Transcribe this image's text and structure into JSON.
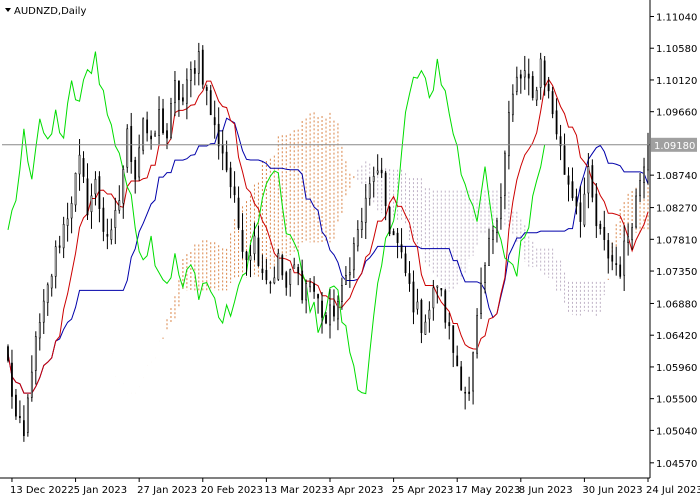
{
  "chart_data": {
    "type": "line",
    "title": "AUDNZD,Daily",
    "symbol": "AUDNZD",
    "timeframe": "Daily",
    "ylim": [
      1.0435,
      1.1125
    ],
    "yticks": [
      "1.11040",
      "1.10580",
      "1.10120",
      "1.09660",
      "1.08740",
      "1.08270",
      "1.07810",
      "1.07350",
      "1.06880",
      "1.06420",
      "1.05960",
      "1.05500",
      "1.05040",
      "1.04570"
    ],
    "current_price": "1.09180",
    "current_price_value": 1.0918,
    "xticks": [
      "13 Dec 2022",
      "5 Jan 2023",
      "27 Jan 2023",
      "20 Feb 2023",
      "13 Mar 2023",
      "3 Apr 2023",
      "25 Apr 2023",
      "17 May 2023",
      "8 Jun 2023",
      "30 Jun 2023",
      "24 Jul 2023"
    ],
    "xtick_index": [
      1,
      17,
      33,
      49,
      65,
      81,
      97,
      113,
      129,
      145,
      161
    ],
    "bar_count": 162,
    "close_anchors": [
      [
        0,
        1.06
      ],
      [
        2,
        1.052
      ],
      [
        4,
        1.049
      ],
      [
        6,
        1.06
      ],
      [
        9,
        1.068
      ],
      [
        12,
        1.076
      ],
      [
        15,
        1.082
      ],
      [
        18,
        1.089
      ],
      [
        20,
        1.083
      ],
      [
        22,
        1.086
      ],
      [
        24,
        1.08
      ],
      [
        26,
        1.078
      ],
      [
        28,
        1.084
      ],
      [
        30,
        1.093
      ],
      [
        32,
        1.088
      ],
      [
        34,
        1.096
      ],
      [
        36,
        1.091
      ],
      [
        38,
        1.096
      ],
      [
        40,
        1.093
      ],
      [
        42,
        1.1
      ],
      [
        44,
        1.098
      ],
      [
        46,
        1.102
      ],
      [
        48,
        1.105
      ],
      [
        50,
        1.099
      ],
      [
        52,
        1.094
      ],
      [
        54,
        1.091
      ],
      [
        56,
        1.086
      ],
      [
        58,
        1.08
      ],
      [
        60,
        1.076
      ],
      [
        62,
        1.078
      ],
      [
        64,
        1.074
      ],
      [
        66,
        1.072
      ],
      [
        68,
        1.075
      ],
      [
        70,
        1.071
      ],
      [
        72,
        1.074
      ],
      [
        74,
        1.071
      ],
      [
        76,
        1.072
      ],
      [
        78,
        1.069
      ],
      [
        80,
        1.066
      ],
      [
        82,
        1.068
      ],
      [
        84,
        1.07
      ],
      [
        86,
        1.075
      ],
      [
        88,
        1.079
      ],
      [
        90,
        1.083
      ],
      [
        92,
        1.088
      ],
      [
        94,
        1.086
      ],
      [
        96,
        1.08
      ],
      [
        98,
        1.077
      ],
      [
        100,
        1.073
      ],
      [
        102,
        1.069
      ],
      [
        104,
        1.066
      ],
      [
        106,
        1.068
      ],
      [
        108,
        1.072
      ],
      [
        110,
        1.067
      ],
      [
        112,
        1.062
      ],
      [
        114,
        1.058
      ],
      [
        116,
        1.055
      ],
      [
        118,
        1.066
      ],
      [
        120,
        1.074
      ],
      [
        122,
        1.08
      ],
      [
        124,
        1.085
      ],
      [
        126,
        1.096
      ],
      [
        128,
        1.101
      ],
      [
        130,
        1.102
      ],
      [
        132,
        1.098
      ],
      [
        134,
        1.104
      ],
      [
        136,
        1.099
      ],
      [
        138,
        1.094
      ],
      [
        140,
        1.088
      ],
      [
        142,
        1.085
      ],
      [
        144,
        1.082
      ],
      [
        146,
        1.087
      ],
      [
        148,
        1.08
      ],
      [
        150,
        1.077
      ],
      [
        152,
        1.075
      ],
      [
        154,
        1.074
      ],
      [
        156,
        1.079
      ],
      [
        158,
        1.084
      ],
      [
        160,
        1.09
      ],
      [
        161,
        1.0918
      ]
    ],
    "series": [
      {
        "key": "price",
        "color": "#000000"
      },
      {
        "key": "tenkan",
        "color": "#cc0000"
      },
      {
        "key": "kijun",
        "color": "#0000aa"
      },
      {
        "key": "chikou",
        "color": "#00dd00"
      },
      {
        "key": "span_a",
        "color": "#d2691e"
      },
      {
        "key": "span_b",
        "color": "#b0a0b8"
      }
    ],
    "ichimoku": {
      "tenkan": 9,
      "kijun": 26,
      "senkou_b": 52,
      "shift": 26
    },
    "grid": false
  }
}
